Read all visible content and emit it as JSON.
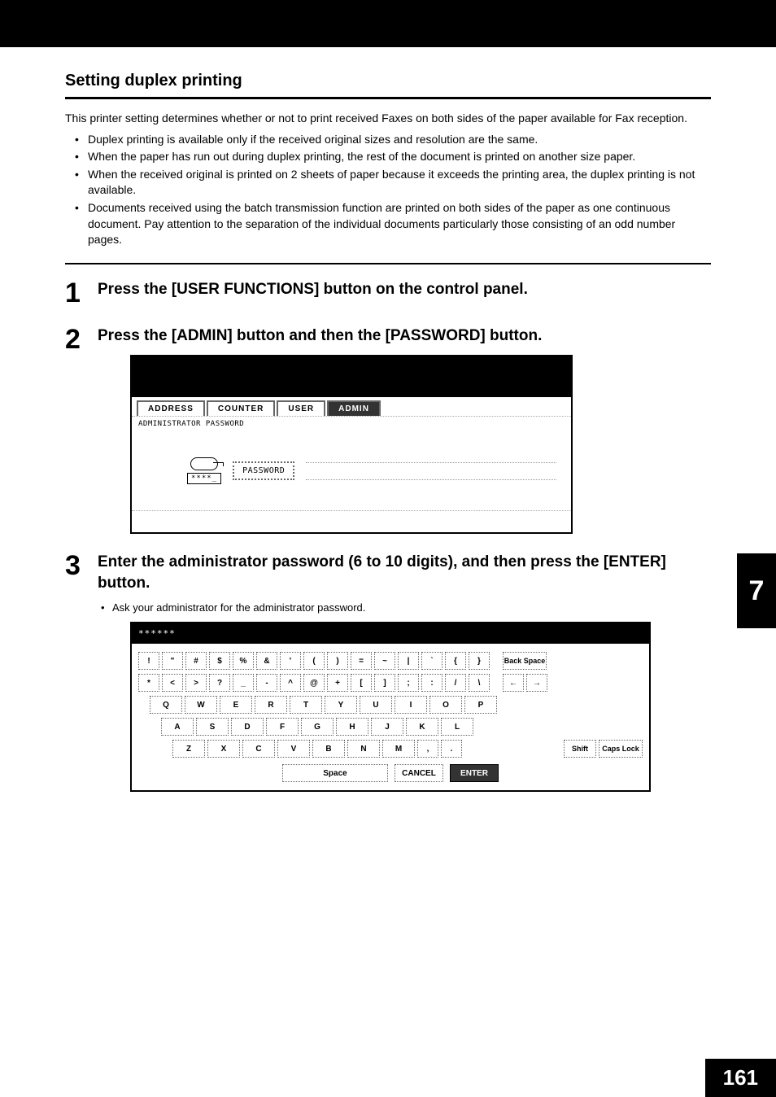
{
  "section_title": "Setting duplex printing",
  "intro": "This printer setting determines whether or not to print received Faxes on both sides of the paper available for Fax reception.",
  "bullets": [
    "Duplex printing is available only if the received original sizes and resolution are the same.",
    "When the paper has run out during duplex printing, the rest of the document is printed on another size paper.",
    "When the received original is printed on 2 sheets of paper because it exceeds the printing area, the duplex printing is not available.",
    "Documents received using the batch transmission function are printed on both sides of the paper as one continuous document. Pay attention to the separation of the individual documents particularly those consisting of an odd number pages."
  ],
  "steps": [
    {
      "num": "1",
      "title": "Press the [USER FUNCTIONS] button on the control panel."
    },
    {
      "num": "2",
      "title": "Press the [ADMIN] button and then the [PASSWORD] button."
    },
    {
      "num": "3",
      "title": "Enter the administrator password (6 to 10 digits), and then press the [ENTER] button.",
      "note": "Ask your administrator for the administrator password."
    }
  ],
  "screenshot1": {
    "tabs": [
      "ADDRESS",
      "COUNTER",
      "USER",
      "ADMIN"
    ],
    "active_tab_index": 3,
    "label": "ADMINISTRATOR PASSWORD",
    "stars": "****_",
    "password_button": "PASSWORD"
  },
  "screenshot2": {
    "input_value": "******",
    "row1": [
      "!",
      "\"",
      "#",
      "$",
      "%",
      "&",
      "'",
      "(",
      ")",
      "=",
      "~",
      "|",
      "`",
      "{",
      "}"
    ],
    "row1_right": "Back Space",
    "row2": [
      "*",
      "<",
      ">",
      "?",
      "_",
      "-",
      "^",
      "@",
      "+",
      "[",
      "]",
      ";",
      ":",
      "/",
      "\\"
    ],
    "row2_right": [
      "←",
      "→"
    ],
    "row3": [
      "Q",
      "W",
      "E",
      "R",
      "T",
      "Y",
      "U",
      "I",
      "O",
      "P"
    ],
    "row4": [
      "A",
      "S",
      "D",
      "F",
      "G",
      "H",
      "J",
      "K",
      "L"
    ],
    "row5": [
      "Z",
      "X",
      "C",
      "V",
      "B",
      "N",
      "M",
      ",",
      "."
    ],
    "row5_right": [
      "Shift",
      "Caps Lock"
    ],
    "bottom": {
      "space": "Space",
      "cancel": "CANCEL",
      "enter": "ENTER"
    }
  },
  "side_tab": "7",
  "page_number": "161"
}
